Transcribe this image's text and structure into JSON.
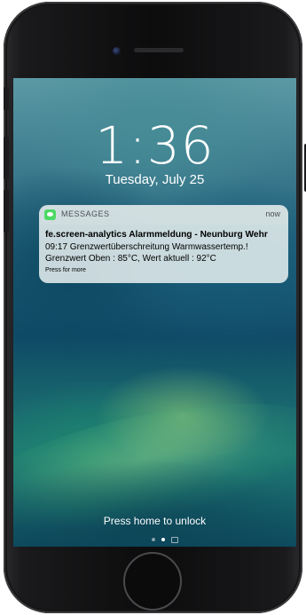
{
  "lock_screen": {
    "time": "1:36",
    "date": "Tuesday, July 25",
    "unlock_hint": "Press home to unlock"
  },
  "notification": {
    "app_icon": "messages-bubble-icon",
    "app_name": "MESSAGES",
    "time": "now",
    "title": "fe.screen-analytics Alarmmeldung - Neunburg Wehr",
    "line1": "09:17 Grenzwertüberschreitung Warmwassertemp.!",
    "line2": "Grenzwert Oben : 85°C, Wert aktuell : 92°C",
    "more": "Press for more"
  },
  "page_indicator": {
    "pages": 3,
    "current": 2,
    "last_icon": "camera-icon"
  },
  "colors": {
    "app_icon_green": "#4cd964",
    "wallpaper_dark": "#0f4a66",
    "wallpaper_light": "#5b9aa4"
  }
}
